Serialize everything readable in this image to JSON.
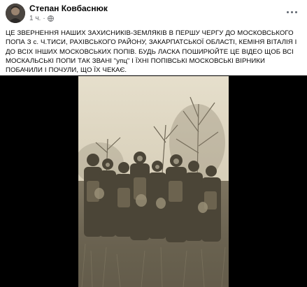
{
  "post": {
    "author_name": "Степан Ковбаснюк",
    "timestamp": "1 ч.",
    "separator": "·",
    "text": "ЦЕ ЗВЕРНЕННЯ НАШИХ ЗАХИСНИКІВ-ЗЕМЛЯКІВ В ПЕРШУ ЧЕРГУ ДО МОСКОВСЬКОГО ПОПА З с. Ч.ТИСИ, РАХІВСЬКОГО РАЙОНУ, ЗАКАРПАТСЬКОЇ ОБЛАСТІ, КЕМІНЯ ВІТАЛІЯ І ДО ВСІХ ІНШИХ МОСКОВСЬКИХ ПОПІВ. БУДЬ ЛАСКА ПОШИРЮЙТЕ ЦЕ ВІДЕО ЩОБ ВСІ МОСКАЛЬСЬКІ ПОПИ ТАК ЗВАНІ \"упц\" І ЇХНІ ПОПІВСЬКІ МОСКОВСЬКІ ВІРНИКИ ПОБАЧИЛИ І ПОЧУЛИ, ЩО ЇХ ЧЕКАЄ."
  },
  "icons": {
    "audience": "globe-icon",
    "menu": "more-options-icon"
  },
  "colors": {
    "text": "#050505",
    "secondary": "#65676b",
    "media_background": "#000000",
    "photo_tone": "#b9ae95"
  }
}
